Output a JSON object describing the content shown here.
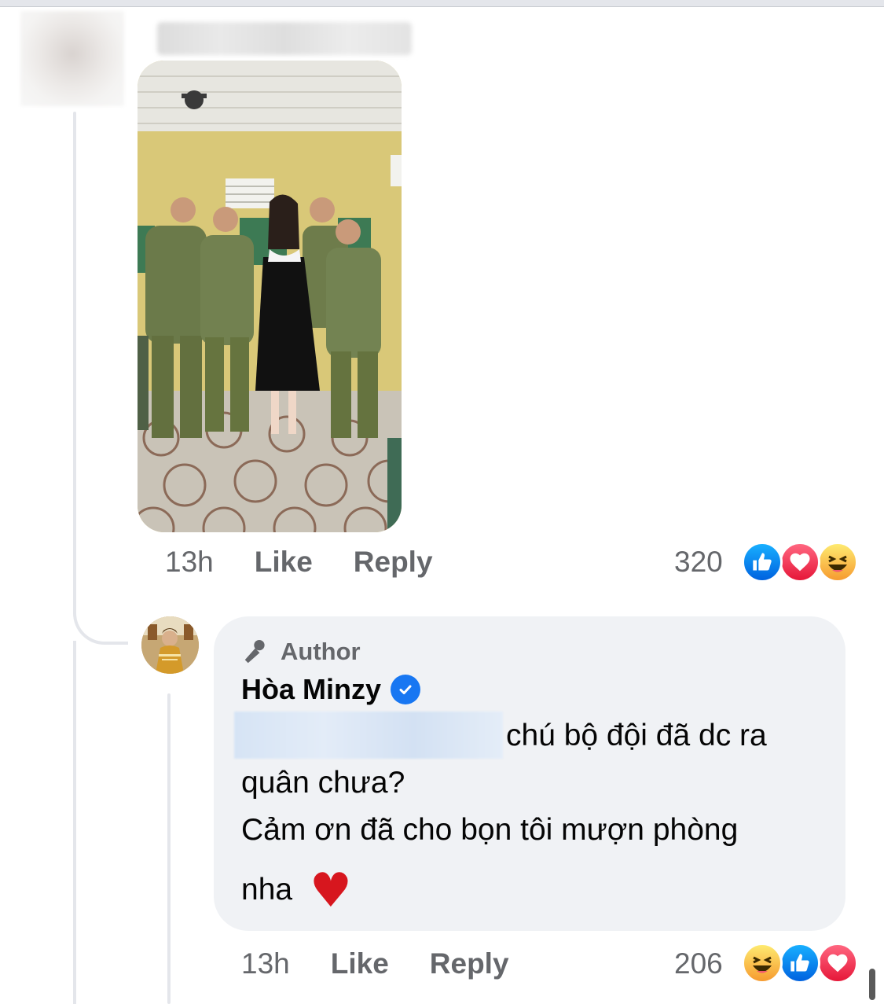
{
  "comment": {
    "time": "13h",
    "like_label": "Like",
    "reply_label": "Reply",
    "reaction_count": "320",
    "reactions": [
      "like-icon",
      "love-icon",
      "haha-icon"
    ]
  },
  "reply": {
    "badge_label": "Author",
    "author_name": "Hòa Minzy",
    "text_line1": "chú bộ đội đã dc ra",
    "text_line2": "quân chưa?",
    "text_line3": "Cảm ơn đã cho bọn tôi mượn phòng",
    "text_line4": "nha",
    "heart_emoji": "♥",
    "time": "13h",
    "like_label": "Like",
    "reply_label": "Reply",
    "reaction_count": "206",
    "reactions": [
      "haha-icon",
      "like-icon",
      "love-icon"
    ]
  },
  "colors": {
    "like": "#1877f2",
    "love": "#f33e58",
    "haha": "#f7b125",
    "bubble": "#f0f2f5",
    "meta": "#65676b"
  }
}
